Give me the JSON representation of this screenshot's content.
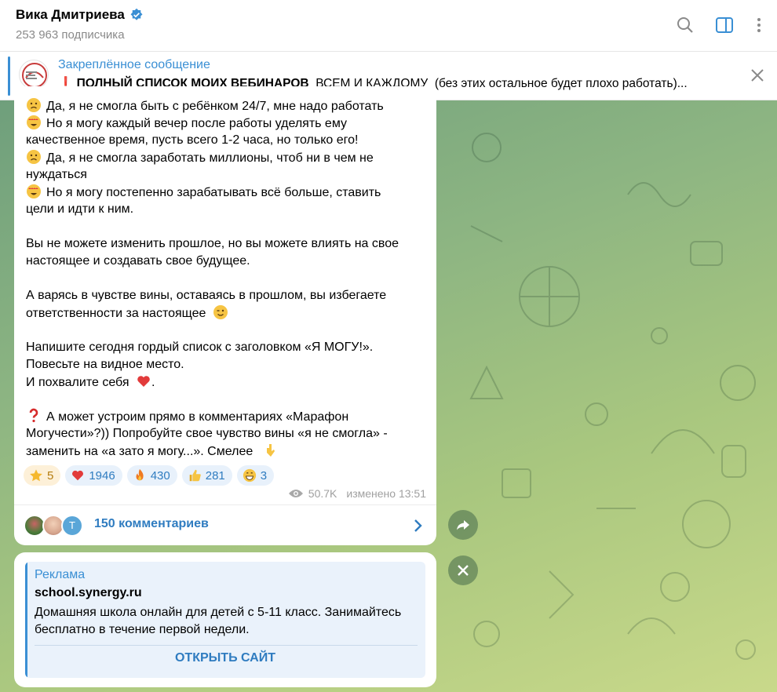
{
  "header": {
    "channel_name": "Вика Дмитриева",
    "subscribers": "253 963 подписчика"
  },
  "pinned": {
    "title": "Закреплённое сообщение",
    "emoji": "❗",
    "text_bold": "ПОЛНЫЙ СПИСОК МОИХ ВЕБИНАРОВ",
    "text_rest": "  ВСЕМ И КАЖДОМУ  (без этих остальное будет плохо работать)..."
  },
  "message": {
    "lines": [
      "Да, я не смогла быть с ребёнком 24/7, мне надо работать",
      "Но я могу каждый вечер после работы уделять ему",
      "качественное время, пусть всего 1-2 часа, но только его!",
      "Да, я не смогла заработать миллионы, чтоб ни в чем не",
      "нуждаться",
      "Но я могу постепенно зарабатывать всё больше, ставить",
      "цели и идти к ним.",
      "Вы не можете изменить прошлое, но вы можете влиять на свое",
      "настоящее и создавать свое будущее.",
      "А варясь в чувстве вины, оставаясь в прошлом, вы избегаете",
      "ответственности за настоящее",
      "Напишите сегодня гордый список с заголовком «Я МОГУ!».",
      "Повесьте на видное место.",
      "И похвалите себя",
      "А может устроим прямо в комментариях «Марафон",
      "Могучести»?)) Попробуйте свое чувство вины «я не смогла» -",
      "заменить на «а зато я могу...». Смелее"
    ],
    "reactions": [
      {
        "emoji": "star",
        "count": "5"
      },
      {
        "emoji": "heart",
        "count": "1946"
      },
      {
        "emoji": "fire",
        "count": "430"
      },
      {
        "emoji": "thumbs-up",
        "count": "281"
      },
      {
        "emoji": "grin",
        "count": "3"
      }
    ],
    "views": "50.7K",
    "edited_time": "изменено 13:51",
    "comments_label": "150 комментариев",
    "avatar_letter": "Т"
  },
  "ad": {
    "label": "Реклама",
    "site": "school.synergy.ru",
    "description": "Домашняя школа онлайн для детей с 5-11 класс. Занимайтесь бесплатно в течение первой недели.",
    "button": "ОТКРЫТЬ САЙТ"
  },
  "colors": {
    "accent": "#3a8fd4",
    "link": "#2f7cc0"
  }
}
